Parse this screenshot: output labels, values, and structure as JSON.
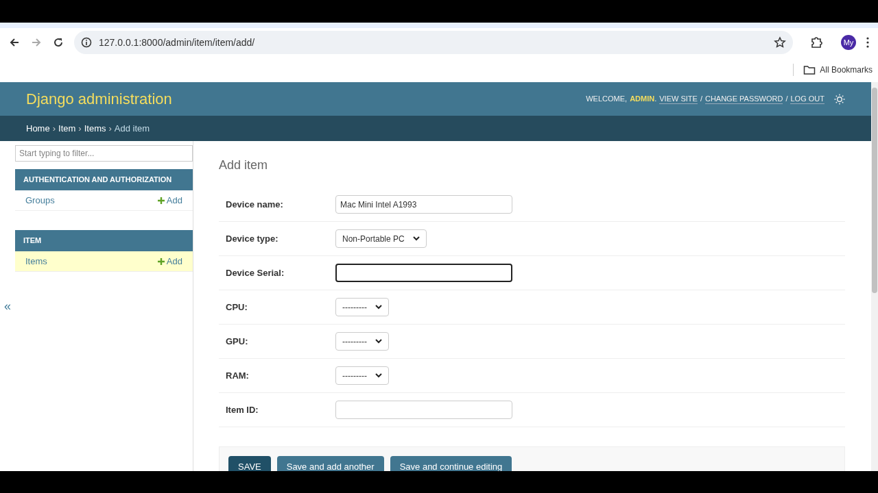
{
  "browser": {
    "url": "127.0.0.1:8000/admin/item/item/add/",
    "profile": "My",
    "bookmarks_label": "All Bookmarks"
  },
  "header": {
    "title": "Django administration",
    "welcome": "WELCOME,",
    "user": "ADMIN",
    "user_suffix": ".",
    "links": [
      "VIEW SITE",
      "CHANGE PASSWORD",
      "LOG OUT"
    ],
    "separator": "/"
  },
  "breadcrumbs": [
    {
      "label": "Home",
      "link": true
    },
    {
      "label": "Item",
      "link": true
    },
    {
      "label": "Items",
      "link": true
    },
    {
      "label": "Add item",
      "link": false
    }
  ],
  "breadcrumb_separator": "›",
  "sidebar": {
    "filter_placeholder": "Start typing to filter...",
    "collapse": "«",
    "apps": [
      {
        "name": "AUTHENTICATION AND AUTHORIZATION",
        "models": [
          {
            "name": "Groups",
            "add": "Add",
            "selected": false
          }
        ]
      },
      {
        "name": "ITEM",
        "models": [
          {
            "name": "Items",
            "add": "Add",
            "selected": true
          }
        ]
      }
    ]
  },
  "page_title": "Add item",
  "fields": [
    {
      "label": "Device name:",
      "kind": "text",
      "value": "Mac Mini Intel A1993",
      "focused": false
    },
    {
      "label": "Device type:",
      "kind": "select",
      "value": "Non-Portable PC",
      "focused": false
    },
    {
      "label": "Device Serial:",
      "kind": "text",
      "focused": true
    },
    {
      "label": "CPU:",
      "kind": "select",
      "value": "---------",
      "focused": false
    },
    {
      "label": "GPU:",
      "kind": "select",
      "value": "---------",
      "focused": false
    },
    {
      "label": "RAM:",
      "kind": "select",
      "value": "---------",
      "focused": false
    },
    {
      "label": "Item ID:",
      "kind": "text",
      "focused": false
    }
  ],
  "buttons": [
    {
      "label": "SAVE",
      "default": true
    },
    {
      "label": "Save and add another",
      "default": false
    },
    {
      "label": "Save and continue editing",
      "default": false
    }
  ]
}
